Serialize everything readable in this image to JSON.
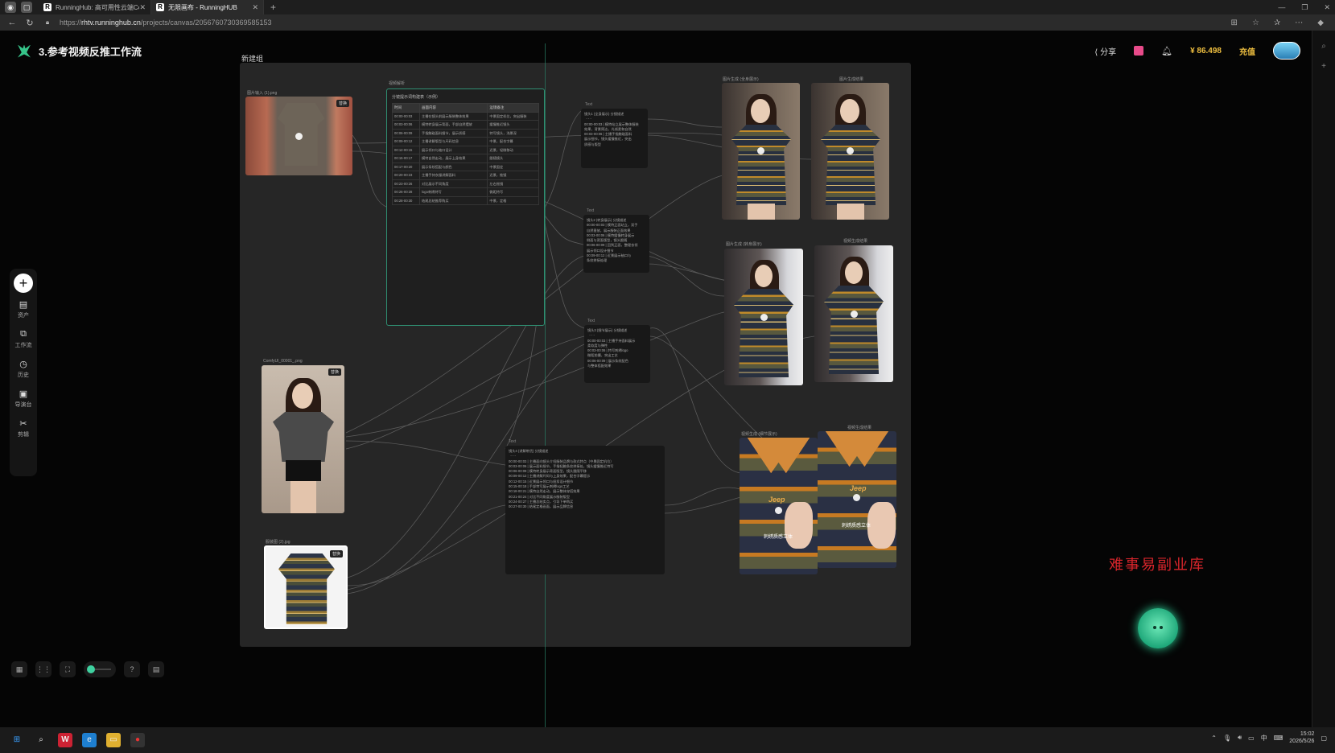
{
  "browser": {
    "tabs": [
      {
        "icon": "R",
        "title": "RunningHub: 高可用性云端Con"
      },
      {
        "icon": "R",
        "title": "无限画布 - RunningHUB"
      }
    ],
    "url_prefix": "https://",
    "url_host": "rhtv.runninghub.cn",
    "url_path": "/projects/canvas/2056760730369585153"
  },
  "app": {
    "title": "3.参考视频反推工作流",
    "share_label": "分享",
    "balance": "86.498",
    "recharge_label": "充值",
    "brand_color": "#36c48a"
  },
  "left_toolbar": {
    "items": [
      {
        "icon": "folder-icon",
        "label": "资产"
      },
      {
        "icon": "workflow-icon",
        "label": "工作流"
      },
      {
        "icon": "history-icon",
        "label": "历史"
      },
      {
        "icon": "director-icon",
        "label": "导演台"
      },
      {
        "icon": "scissors-icon",
        "label": "剪辑"
      }
    ]
  },
  "canvas": {
    "group_label": "新建组",
    "nodes": {
      "tshirt_label": "图片输入 (1).png",
      "tshirt_badge": "替换",
      "table_label": "视频解析",
      "table_title": "分镜提示词构建表（示例）",
      "table_headers": [
        "时间",
        "画面内容",
        "运镜备注"
      ],
      "table_rows": [
        [
          "00:00-00:03",
          "主播在镜头前展示服装整体效果",
          "中景固定机位，突出服装"
        ],
        [
          "00:03-00:06",
          "模特转身展示背面，手部自然摆放",
          "缓慢推近镜头"
        ],
        [
          "00:06-00:09",
          "手指触碰面料细节，展示质感",
          "特写镜头，浅景深"
        ],
        [
          "00:09-00:12",
          "主播讲解版型与尺码信息",
          "中景，配合字幕"
        ],
        [
          "00:12-00:15",
          "展示领口与袖口设计",
          "近景，轻微移动"
        ],
        [
          "00:15-00:17",
          "模特自然走动，展示上身效果",
          "跟随镜头"
        ],
        [
          "00:17-00:20",
          "展示条纹搭配与颜色",
          "中景固定"
        ],
        [
          "00:20-00:23",
          "主播手持衣服讲解面料",
          "近景，推镜"
        ],
        [
          "00:23-00:26",
          "对比展示不同角度",
          "左右摇镜"
        ],
        [
          "00:26-00:28",
          "logo刺绣特写",
          "微距特写"
        ],
        [
          "00:28-00:30",
          "结尾总结推荐购买",
          "中景，定格"
        ]
      ],
      "model_label": "ComfyUI_00001_.png",
      "model_badge": "替换",
      "polo_label": "服装图 (2).jpg",
      "polo_badge": "替换",
      "text_label": "Text",
      "text1": "镜头1 (全身展示) 分镜描述\n  - - -\n00:00-00:03 | 模特站立展示整体服装\n效果，背景简洁，光线柔和自然\n00:03-00:06 | 主播手指触碰面料\n展示细节，镜头缓慢推近，突出\n质感与版型",
      "text2": "镜头2 (转身展示) 分镜描述\n00:00-00:03 | 模特正面站立，双手\n自然垂放，展示服装正面效果\n00:03-00:06 | 模特缓慢转身展示\n侧面与背面版型，镜头跟随\n00:06-00:09 | 回到正面，整理衣领\n展示领口设计细节\n00:09-00:12 | 近景展示袖口与\n条纹拼接处理",
      "text3": "镜头3 (细节展示) 分镜描述\n  - - -\n00:00-00:03 | 主播手持面料展示\n柔软度与弹性\n00:03-00:06 | 特写刺绣logo\n微距拍摄，突出工艺\n00:06-00:09 | 展示条纹配色\n与整体搭配效果",
      "text4": "镜头4 (讲解带货) 分镜描述\n  - - -\n00:00-00:03 | 主播面向镜头介绍服装品牌与款式特点（中景固定机位）\n00:03-00:06 | 展示面料细节，手指轻触条纹拼接处，镜头缓慢推近特写\n00:06-00:09 | 模特转身展示背面版型，镜头跟随平移\n00:09-00:12 | 主播讲解尺码与上身效果，配合字幕提示\n00:12-00:15 | 近景展示领口与纽扣设计细节\n00:15-00:18 | 手部特写展示刺绣logo工艺\n00:18-00:21 | 模特自然走动，展示整体穿搭效果\n00:21-00:24 | 对比不同角度展示服装版型\n00:24-00:27 | 主播总结卖点，引导下单购买\n00:27-00:30 | 结尾定格画面，展示品牌信息",
      "out1_label": "图片生成 (全身展示)",
      "out2_label": "图片生成结果",
      "out3_label": "图片生成 (转身展示)",
      "out4_label": "视频生成结果",
      "out5_label": "视频生成 (细节展示)",
      "out6_label": "视频生成结果",
      "closeup_brand": "Jeep",
      "closeup_caption": "刺绣质感立体"
    }
  },
  "watermark": "难事易副业库",
  "taskbar": {
    "time": "15:02",
    "date": "2026/5/26",
    "ime": "中"
  }
}
